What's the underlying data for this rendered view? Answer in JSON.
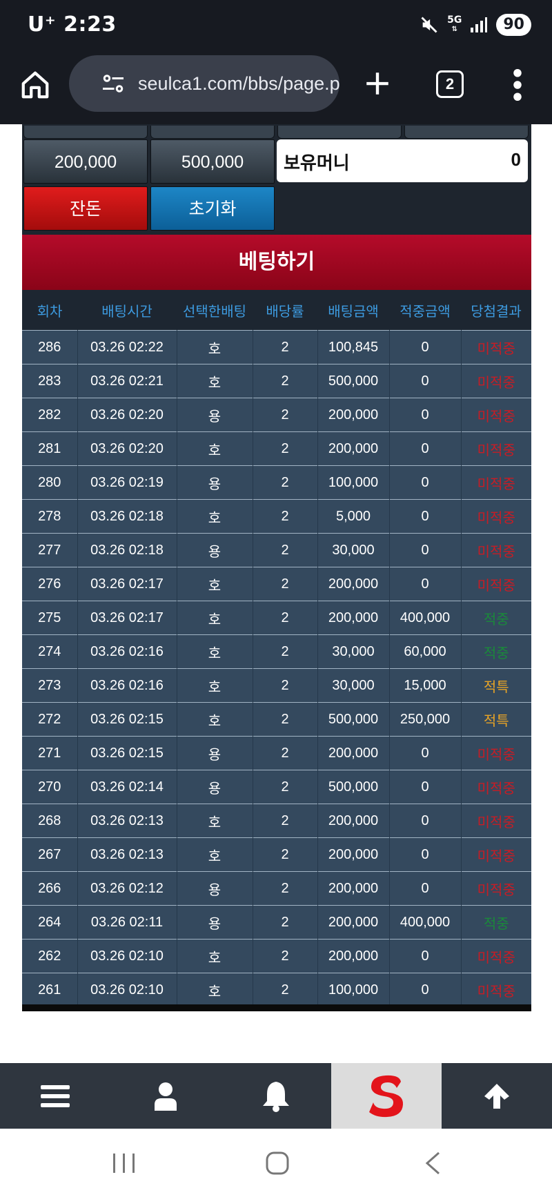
{
  "status_bar": {
    "carrier": "U⁺",
    "time": "2:23",
    "network": "5G",
    "battery": "90"
  },
  "browser": {
    "url": "seulca1.com/bbs/page.ph",
    "tab_count": "2"
  },
  "controls": {
    "amount_200k": "200,000",
    "amount_500k": "500,000",
    "balance_label": "보유머니",
    "balance_value": "0",
    "change_button": "잔돈",
    "reset_button": "초기화"
  },
  "betting": {
    "title": "베팅하기",
    "columns": [
      "회차",
      "배팅시간",
      "선택한배팅",
      "배당률",
      "배팅금액",
      "적중금액",
      "당첨결과"
    ],
    "rows": [
      [
        "286",
        "03.26 02:22",
        "호",
        "2",
        "100,845",
        "0",
        "미적중"
      ],
      [
        "283",
        "03.26 02:21",
        "호",
        "2",
        "500,000",
        "0",
        "미적중"
      ],
      [
        "282",
        "03.26 02:20",
        "용",
        "2",
        "200,000",
        "0",
        "미적중"
      ],
      [
        "281",
        "03.26 02:20",
        "호",
        "2",
        "200,000",
        "0",
        "미적중"
      ],
      [
        "280",
        "03.26 02:19",
        "용",
        "2",
        "100,000",
        "0",
        "미적중"
      ],
      [
        "278",
        "03.26 02:18",
        "호",
        "2",
        "5,000",
        "0",
        "미적중"
      ],
      [
        "277",
        "03.26 02:18",
        "용",
        "2",
        "30,000",
        "0",
        "미적중"
      ],
      [
        "276",
        "03.26 02:17",
        "호",
        "2",
        "200,000",
        "0",
        "미적중"
      ],
      [
        "275",
        "03.26 02:17",
        "호",
        "2",
        "200,000",
        "400,000",
        "적중"
      ],
      [
        "274",
        "03.26 02:16",
        "호",
        "2",
        "30,000",
        "60,000",
        "적중"
      ],
      [
        "273",
        "03.26 02:16",
        "호",
        "2",
        "30,000",
        "15,000",
        "적특"
      ],
      [
        "272",
        "03.26 02:15",
        "호",
        "2",
        "500,000",
        "250,000",
        "적특"
      ],
      [
        "271",
        "03.26 02:15",
        "용",
        "2",
        "200,000",
        "0",
        "미적중"
      ],
      [
        "270",
        "03.26 02:14",
        "용",
        "2",
        "500,000",
        "0",
        "미적중"
      ],
      [
        "268",
        "03.26 02:13",
        "호",
        "2",
        "200,000",
        "0",
        "미적중"
      ],
      [
        "267",
        "03.26 02:13",
        "호",
        "2",
        "200,000",
        "0",
        "미적중"
      ],
      [
        "266",
        "03.26 02:12",
        "용",
        "2",
        "200,000",
        "0",
        "미적중"
      ],
      [
        "264",
        "03.26 02:11",
        "용",
        "2",
        "200,000",
        "400,000",
        "적중"
      ],
      [
        "262",
        "03.26 02:10",
        "호",
        "2",
        "200,000",
        "0",
        "미적중"
      ],
      [
        "261",
        "03.26 02:10",
        "호",
        "2",
        "100,000",
        "0",
        "미적중"
      ]
    ]
  },
  "colors": {
    "lose": "#c91c24",
    "win": "#1a8a3a",
    "special": "#e9a425",
    "header_red": "#a0061f",
    "row_bg": "#34495e"
  },
  "icons": {
    "bottom_nav": [
      "menu-icon",
      "user-icon",
      "bell-icon",
      "site-logo",
      "arrow-up-icon"
    ],
    "system_nav": [
      "recents-icon",
      "home-icon",
      "back-icon"
    ]
  }
}
